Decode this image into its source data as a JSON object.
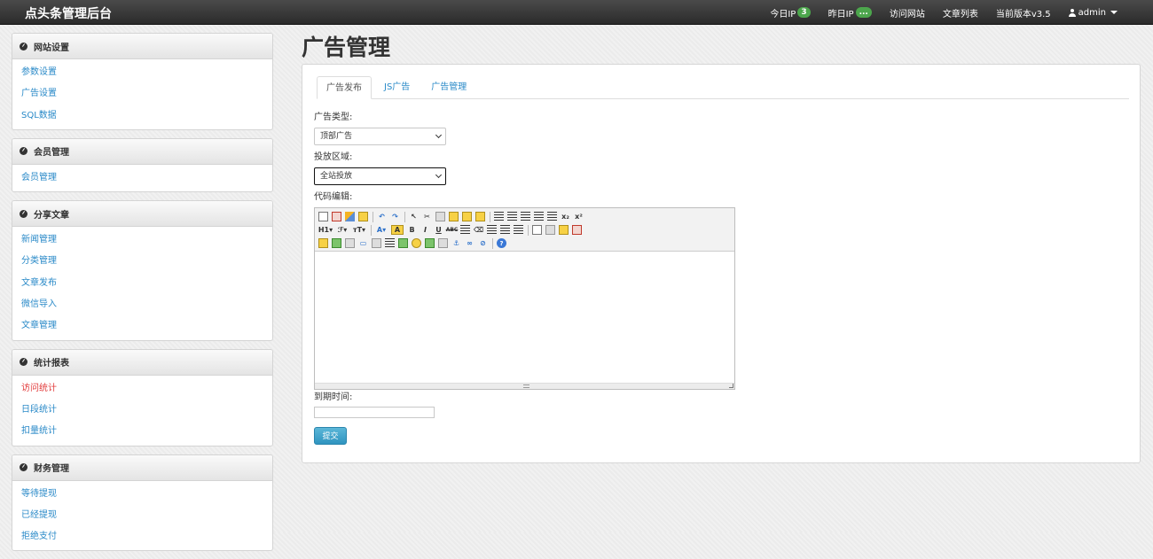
{
  "app": {
    "brand": "点头条管理后台"
  },
  "navbar": {
    "today_ip_label": "今日IP",
    "today_ip_count": "3",
    "yesterday_ip_label": "昨日IP",
    "yesterday_ip_count": "...",
    "visit_site": "访问网站",
    "article_list": "文章列表",
    "version": "当前版本v3.5",
    "user": "admin"
  },
  "sidebar": [
    {
      "title": "网站设置",
      "items": [
        {
          "label": "参数设置",
          "active": false
        },
        {
          "label": "广告设置",
          "active": false
        },
        {
          "label": "SQL数据",
          "active": false
        }
      ]
    },
    {
      "title": "会员管理",
      "items": [
        {
          "label": "会员管理",
          "active": false
        }
      ]
    },
    {
      "title": "分享文章",
      "items": [
        {
          "label": "新闻管理",
          "active": false
        },
        {
          "label": "分类管理",
          "active": false
        },
        {
          "label": "文章发布",
          "active": false
        },
        {
          "label": "微信导入",
          "active": false
        },
        {
          "label": "文章管理",
          "active": false
        }
      ]
    },
    {
      "title": "统计报表",
      "items": [
        {
          "label": "访问统计",
          "active": true
        },
        {
          "label": "日段统计",
          "active": false
        },
        {
          "label": "扣量统计",
          "active": false
        }
      ]
    },
    {
      "title": "财务管理",
      "items": [
        {
          "label": "等待提现",
          "active": false
        },
        {
          "label": "已经提现",
          "active": false
        },
        {
          "label": "拒绝支付",
          "active": false
        }
      ]
    }
  ],
  "main": {
    "page_title": "广告管理",
    "tabs": [
      "广告发布",
      "JS广告",
      "广告管理"
    ],
    "active_tab": 0,
    "form": {
      "ad_type_label": "广告类型:",
      "ad_type_value": "顶部广告",
      "region_label": "投放区域:",
      "region_value": "全站投放",
      "code_label": "代码编辑:",
      "expire_label": "到期时间:",
      "expire_value": "",
      "submit_label": "提交"
    }
  },
  "colors": {
    "link": "#2a8ac8",
    "active_link": "#e23b3b",
    "badge": "#4ca64c",
    "submit": "#3aa0cc"
  }
}
